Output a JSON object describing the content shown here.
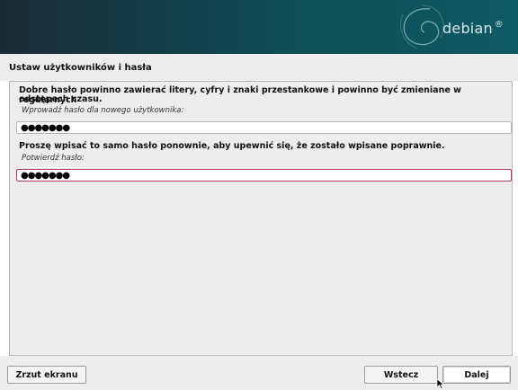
{
  "header": {
    "brand": "debian",
    "brand_mark": "®"
  },
  "page": {
    "title": "Ustaw użytkowników i hasła"
  },
  "form": {
    "instruction_line1": "Dobre hasło powinno zawierać litery, cyfry i znaki przestankowe i powinno być zmieniane w regularnych",
    "instruction_line2": "odstępach czasu.",
    "password_label": "Wprowadź hasło dla nowego użytkownika:",
    "password_value": "●●●●●●●",
    "repeat_instruction": "Proszę wpisać to samo hasło ponownie, aby upewnić się, że zostało wpisane poprawnie.",
    "confirm_label": "Potwierdź hasło:",
    "confirm_value": "●●●●●●●"
  },
  "buttons": {
    "screenshot": "Zrzut ekranu",
    "back": "Wstecz",
    "continue": "Dalej"
  }
}
